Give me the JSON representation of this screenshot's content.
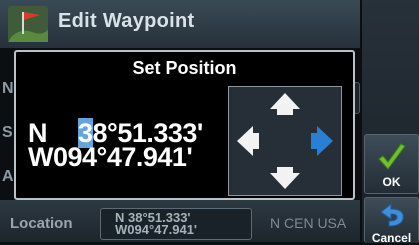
{
  "header": {
    "title": "Edit Waypoint",
    "icon": "waypoint-flag-icon"
  },
  "dialog": {
    "title": "Set Position",
    "lat_hem": "N",
    "lat_sel": "3",
    "lat_rest": "8°51.333'",
    "lon": "W094°47.941'"
  },
  "dpad": {
    "icons": [
      "arrow-up-icon",
      "arrow-down-icon",
      "arrow-left-icon",
      "arrow-right-icon"
    ],
    "active": "arrow-right-icon"
  },
  "background": {
    "letters": [
      "N",
      "S",
      "A"
    ]
  },
  "footer": {
    "location_label": "Location",
    "lat": "N  38°51.333'",
    "lon": "W094°47.941'",
    "region": "N CEN USA"
  },
  "buttons": {
    "ok": "OK",
    "cancel": "Cancel"
  },
  "colors": {
    "highlight": "#63a5dc",
    "active_arrow": "#2a7fd4",
    "ok_green": "#6fc22c",
    "cancel_blue": "#3f8fd8"
  }
}
